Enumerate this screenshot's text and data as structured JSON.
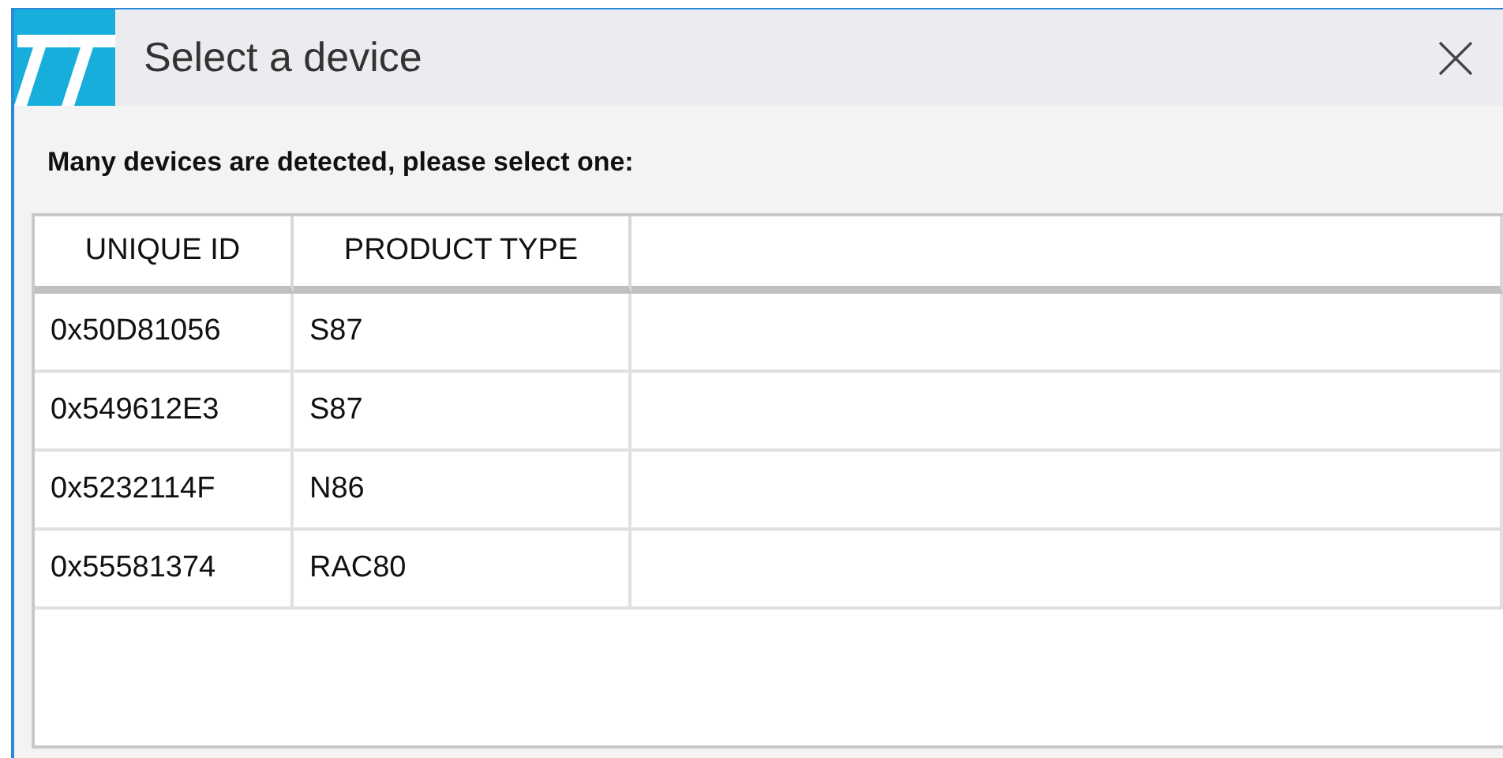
{
  "window": {
    "title": "Select a device"
  },
  "message": "Many devices are detected, please select one:",
  "table": {
    "columns": [
      "UNIQUE ID",
      "PRODUCT TYPE"
    ],
    "rows": [
      [
        "0x50D81056",
        "S87"
      ],
      [
        "0x549612E3",
        "S87"
      ],
      [
        "0x5232114F",
        "N86"
      ],
      [
        "0x55581374",
        "RAC80"
      ]
    ]
  }
}
